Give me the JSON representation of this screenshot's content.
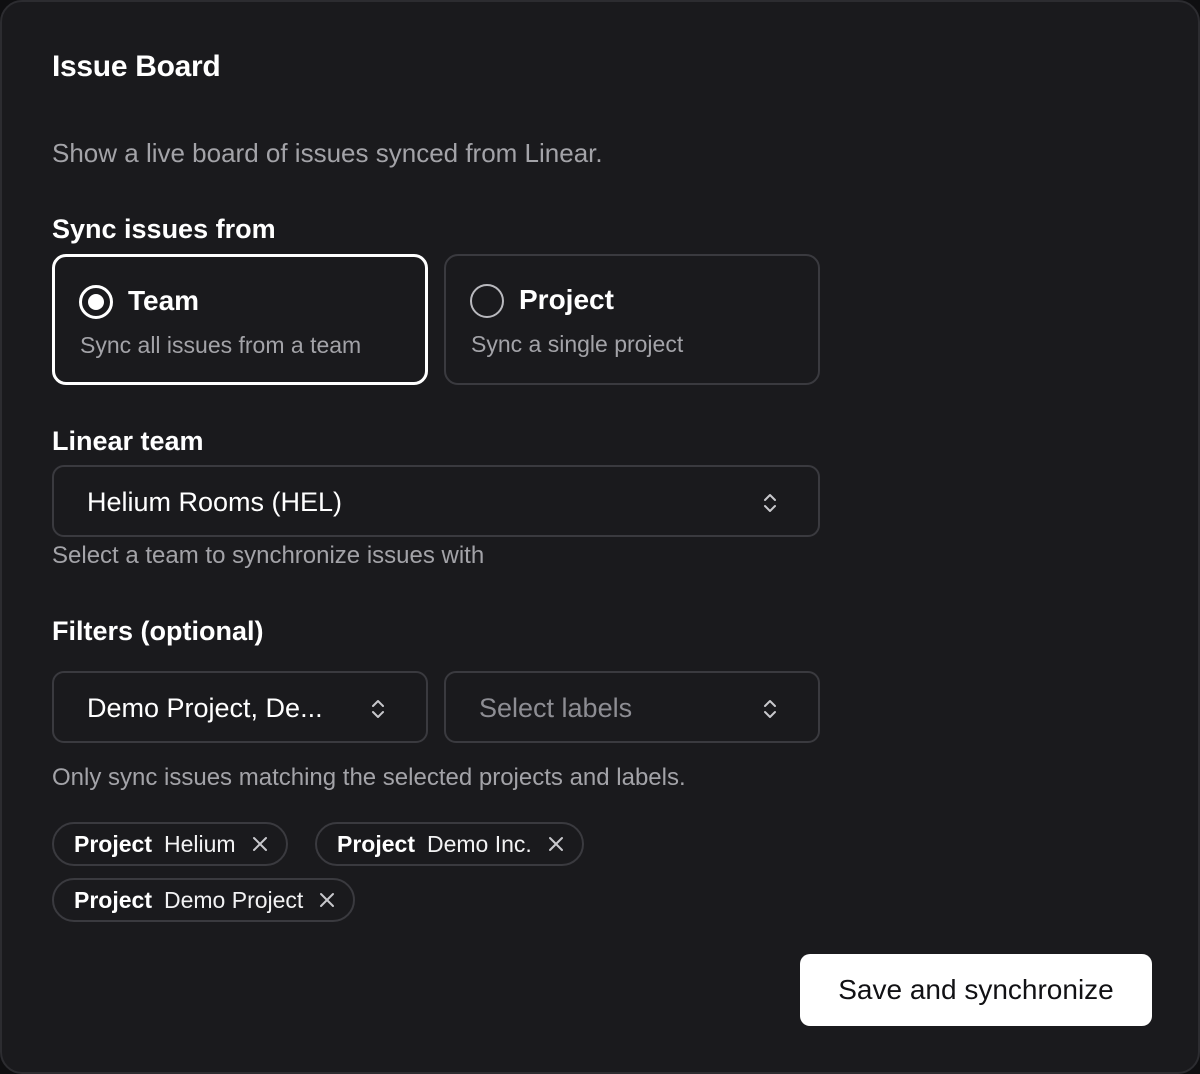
{
  "header": {
    "title": "Issue Board",
    "description": "Show a live board of issues synced from Linear."
  },
  "sync_source": {
    "label": "Sync issues from",
    "options": [
      {
        "title": "Team",
        "subtitle": "Sync all issues from a team",
        "selected": true
      },
      {
        "title": "Project",
        "subtitle": "Sync a single project",
        "selected": false
      }
    ]
  },
  "team": {
    "label": "Linear team",
    "value": "Helium Rooms (HEL)",
    "hint": "Select a team to synchronize issues with"
  },
  "filters": {
    "label": "Filters (optional)",
    "projects_value": "Demo Project, De...",
    "labels_placeholder": "Select labels",
    "hint": "Only sync issues matching the selected projects and labels.",
    "chips": [
      {
        "key": "Project",
        "value": "Helium"
      },
      {
        "key": "Project",
        "value": "Demo Inc."
      },
      {
        "key": "Project",
        "value": "Demo Project"
      }
    ]
  },
  "actions": {
    "save_label": "Save and synchronize"
  },
  "colors": {
    "background": "#1a1a1d",
    "border": "#3a3a3f",
    "text_primary": "#ffffff",
    "text_secondary": "#a3a3a8",
    "button_bg": "#ffffff"
  }
}
